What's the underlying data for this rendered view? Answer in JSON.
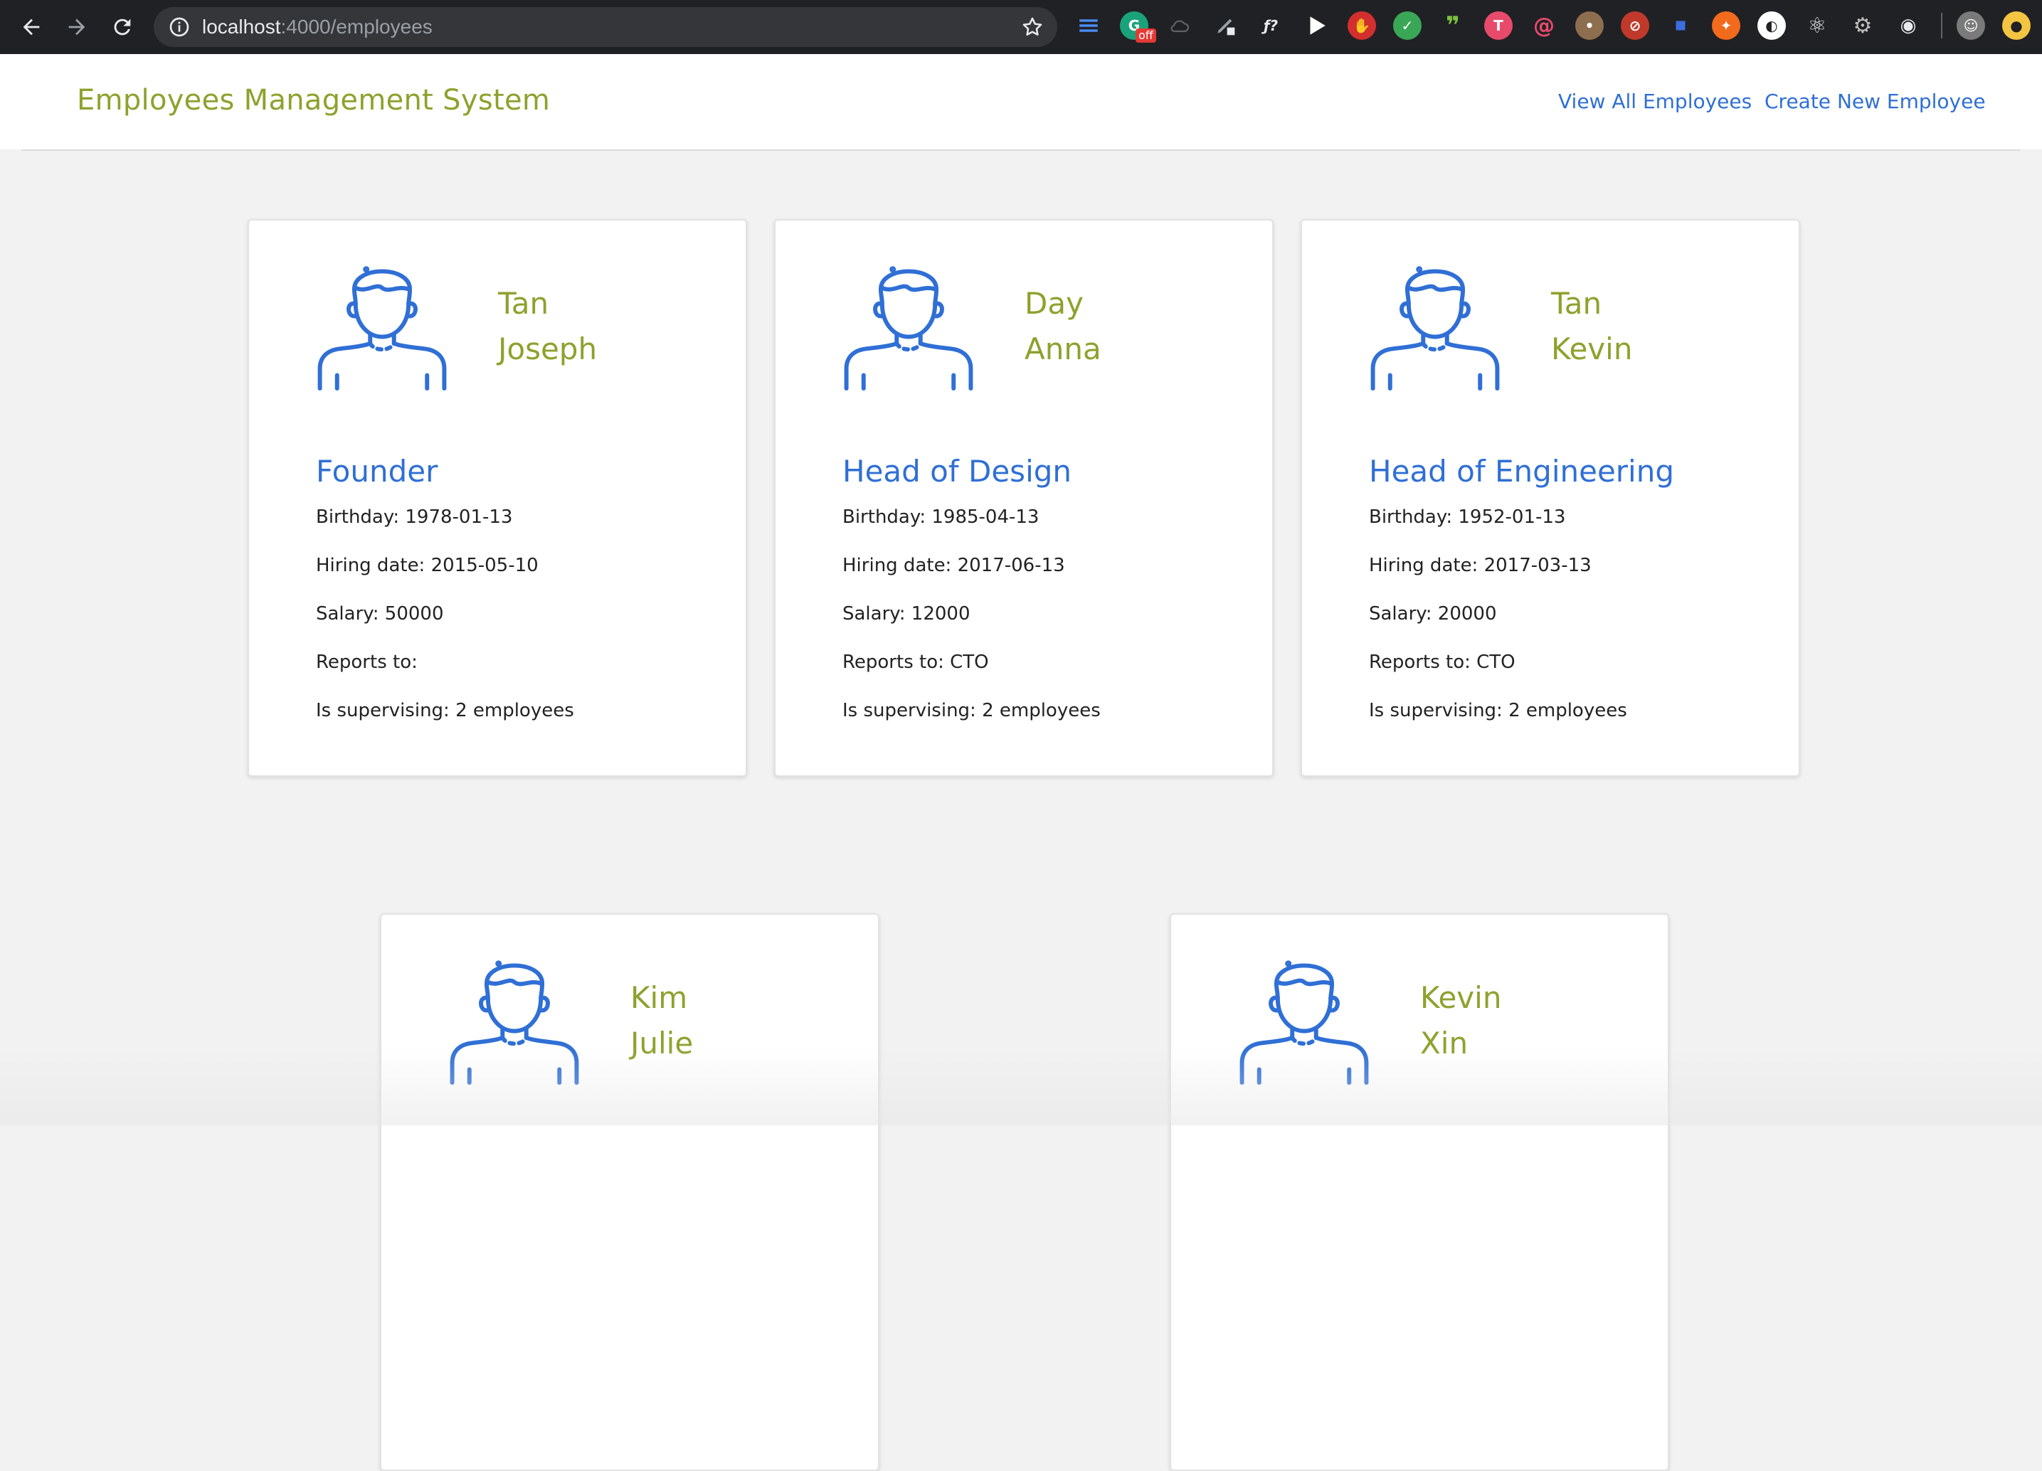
{
  "browser": {
    "url_host": "localhost",
    "url_rest": ":4000/employees",
    "extension_off_badge": "off"
  },
  "header": {
    "brand": "Employees Management System",
    "nav": {
      "view_all": "View All Employees",
      "create_new": "Create New Employee"
    }
  },
  "employees": [
    {
      "last_name": "Tan",
      "first_name": "Joseph",
      "title": "Founder",
      "birthday": "Birthday: 1978-01-13",
      "hiring_date": "Hiring date: 2015-05-10",
      "salary": "Salary: 50000",
      "reports_to": "Reports to:",
      "supervising": "Is supervising: 2 employees"
    },
    {
      "last_name": "Day",
      "first_name": "Anna",
      "title": "Head of Design",
      "birthday": "Birthday: 1985-04-13",
      "hiring_date": "Hiring date: 2017-06-13",
      "salary": "Salary: 12000",
      "reports_to": "Reports to: CTO",
      "supervising": "Is supervising: 2 employees"
    },
    {
      "last_name": "Tan",
      "first_name": "Kevin",
      "title": "Head of Engineering",
      "birthday": "Birthday: 1952-01-13",
      "hiring_date": "Hiring date: 2017-03-13",
      "salary": "Salary: 20000",
      "reports_to": "Reports to: CTO",
      "supervising": "Is supervising: 2 employees"
    },
    {
      "last_name": "Kim",
      "first_name": "Julie"
    },
    {
      "last_name": "Kevin",
      "first_name": "Xin"
    }
  ],
  "colors": {
    "brand_green": "#8fa12d",
    "link_blue": "#2f6fd6",
    "avatar_blue": "#2f6fd6",
    "page_bg": "#f2f2f2"
  }
}
